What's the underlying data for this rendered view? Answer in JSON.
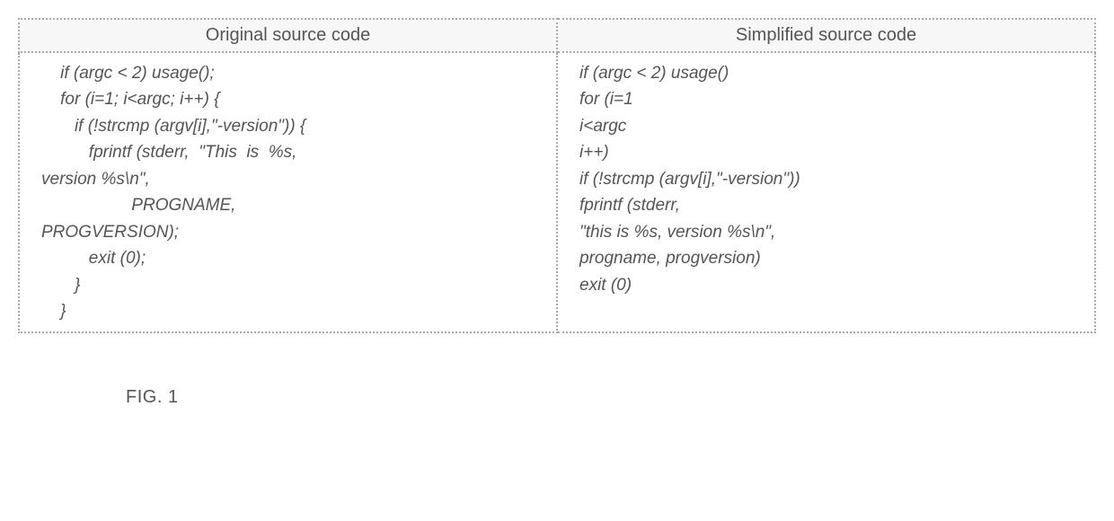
{
  "table": {
    "headers": {
      "left": "Original source code",
      "right": "Simplified source code"
    },
    "left_code": "    if (argc < 2) usage();\n    for (i=1; i<argc; i++) {\n       if (!strcmp (argv[i],\"-version\")) {\n          fprintf (stderr,  \"This  is  %s,\nversion %s\\n\",\n                   PROGNAME,\nPROGVERSION);\n          exit (0);\n       }\n    }",
    "right_code": "if (argc < 2) usage()\nfor (i=1\ni<argc\ni++)\nif (!strcmp (argv[i],\"-version\"))\nfprintf (stderr,\n\"this is %s, version %s\\n\",\nprogname, progversion)\nexit (0)"
  },
  "caption": "FIG. 1"
}
